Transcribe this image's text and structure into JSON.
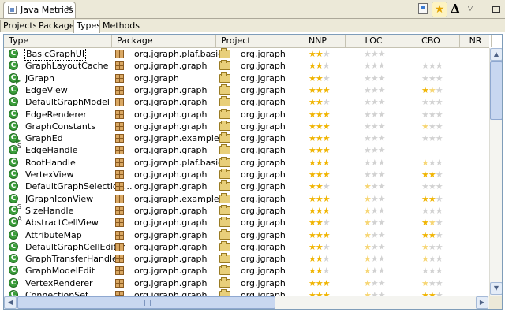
{
  "view": {
    "title": "Java Metrics",
    "close": "✕"
  },
  "toolbar": {
    "star": "★",
    "delta": "Δ",
    "menu": "▽",
    "minimize": "—"
  },
  "tabs": [
    "Projects",
    "Packages",
    "Types",
    "Methods"
  ],
  "selected_tab": "Types",
  "columns": [
    "Type",
    "Package",
    "Project",
    "NNP",
    "LOC",
    "CBO",
    "NR"
  ],
  "rating_max": 3,
  "rows": [
    {
      "type": "BasicGraphUI",
      "package": "org.jgraph.plaf.basic",
      "project": "org.jgraph",
      "mod": "",
      "nnp": 2,
      "loc": 0,
      "cbo": null
    },
    {
      "type": "GraphLayoutCache",
      "package": "org.jgraph.graph",
      "project": "org.jgraph",
      "mod": "",
      "nnp": 2,
      "loc": 0,
      "cbo": 0
    },
    {
      "type": "JGraph",
      "package": "org.jgraph",
      "project": "org.jgraph",
      "mod": "run",
      "nnp": 2,
      "loc": 0,
      "cbo": 0
    },
    {
      "type": "EdgeView",
      "package": "org.jgraph.graph",
      "project": "org.jgraph",
      "mod": "",
      "nnp": 3,
      "loc": 0,
      "cbo": 1.5
    },
    {
      "type": "DefaultGraphModel",
      "package": "org.jgraph.graph",
      "project": "org.jgraph",
      "mod": "",
      "nnp": 2,
      "loc": 0,
      "cbo": 0
    },
    {
      "type": "EdgeRenderer",
      "package": "org.jgraph.graph",
      "project": "org.jgraph",
      "mod": "",
      "nnp": 3,
      "loc": 0,
      "cbo": 0
    },
    {
      "type": "GraphConstants",
      "package": "org.jgraph.graph",
      "project": "org.jgraph",
      "mod": "",
      "nnp": 3,
      "loc": 0,
      "cbo": 0.5
    },
    {
      "type": "GraphEd",
      "package": "org.jgraph.example",
      "project": "org.jgraph",
      "mod": "run",
      "nnp": 3,
      "loc": 0,
      "cbo": 0
    },
    {
      "type": "EdgeHandle",
      "package": "org.jgraph.graph",
      "project": "org.jgraph",
      "mod": "s",
      "nnp": 3,
      "loc": 0,
      "cbo": null
    },
    {
      "type": "RootHandle",
      "package": "org.jgraph.plaf.basic",
      "project": "org.jgraph",
      "mod": "",
      "nnp": 3,
      "loc": 0,
      "cbo": 0.5
    },
    {
      "type": "VertexView",
      "package": "org.jgraph.graph",
      "project": "org.jgraph",
      "mod": "",
      "nnp": 3,
      "loc": 0,
      "cbo": 2
    },
    {
      "type": "DefaultGraphSelection…",
      "package": "org.jgraph.graph",
      "project": "org.jgraph",
      "mod": "",
      "nnp": 2,
      "loc": 0.5,
      "cbo": 0
    },
    {
      "type": "JGraphIconView",
      "package": "org.jgraph.example",
      "project": "org.jgraph",
      "mod": "",
      "nnp": 3,
      "loc": 0.5,
      "cbo": 2
    },
    {
      "type": "SizeHandle",
      "package": "org.jgraph.graph",
      "project": "org.jgraph",
      "mod": "s",
      "nnp": 3,
      "loc": 0.5,
      "cbo": 0
    },
    {
      "type": "AbstractCellView",
      "package": "org.jgraph.graph",
      "project": "org.jgraph",
      "mod": "a",
      "nnp": 2,
      "loc": 0.5,
      "cbo": 1.5
    },
    {
      "type": "AttributeMap",
      "package": "org.jgraph.graph",
      "project": "org.jgraph",
      "mod": "",
      "nnp": 3,
      "loc": 0.5,
      "cbo": 2
    },
    {
      "type": "DefaultGraphCellEditor",
      "package": "org.jgraph.graph",
      "project": "org.jgraph",
      "mod": "",
      "nnp": 2,
      "loc": 0.5,
      "cbo": 0.5
    },
    {
      "type": "GraphTransferHandler",
      "package": "org.jgraph.graph",
      "project": "org.jgraph",
      "mod": "",
      "nnp": 2,
      "loc": 0.5,
      "cbo": 0.5
    },
    {
      "type": "GraphModelEdit",
      "package": "org.jgraph.graph",
      "project": "org.jgraph",
      "mod": "",
      "nnp": 2,
      "loc": 0.5,
      "cbo": 0
    },
    {
      "type": "VertexRenderer",
      "package": "org.jgraph.graph",
      "project": "org.jgraph",
      "mod": "",
      "nnp": 3,
      "loc": 0.5,
      "cbo": 0.5
    },
    {
      "type": "ConnectionSet",
      "package": "org.jgraph.graph",
      "project": "org.jgraph",
      "mod": "",
      "nnp": 3,
      "loc": 0.5,
      "cbo": 2
    }
  ],
  "scroll": {
    "up": "▲",
    "down": "▼",
    "left": "◀",
    "right": "▶"
  },
  "icons": {
    "view-tab": "metrics-view-icon",
    "class": "class-icon",
    "package": "package-icon",
    "project": "project-folder-icon",
    "clip": "clipboard-icon",
    "star": "star-icon",
    "delta": "delta-icon"
  },
  "colors": {
    "star_full": "#f0b400",
    "star_empty": "#d2d2d2",
    "class_green": "#3a9d3a",
    "chrome": "#ece9d8"
  }
}
